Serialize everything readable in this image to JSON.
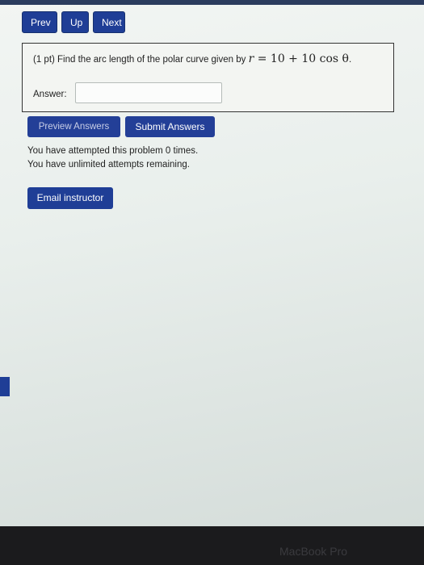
{
  "nav": {
    "prev_label": "Prev",
    "up_label": "Up",
    "next_label": "Next"
  },
  "problem": {
    "prefix": "(1 pt) Find the arc length of the polar curve given by",
    "math_var": "r",
    "math_rest": " = 10 + 10 cos θ",
    "suffix": "."
  },
  "answer": {
    "label": "Answer:",
    "value": ""
  },
  "actions": {
    "preview_label": "Preview Answers",
    "submit_label": "Submit Answers"
  },
  "status": {
    "attempted": "You have attempted this problem 0 times.",
    "remaining": "You have unlimited attempts remaining."
  },
  "email": {
    "label": "Email instructor"
  },
  "device": {
    "brand": "MacBook Pro"
  },
  "colors": {
    "button_blue": "#1f3e96",
    "background": "#eef2f0"
  }
}
